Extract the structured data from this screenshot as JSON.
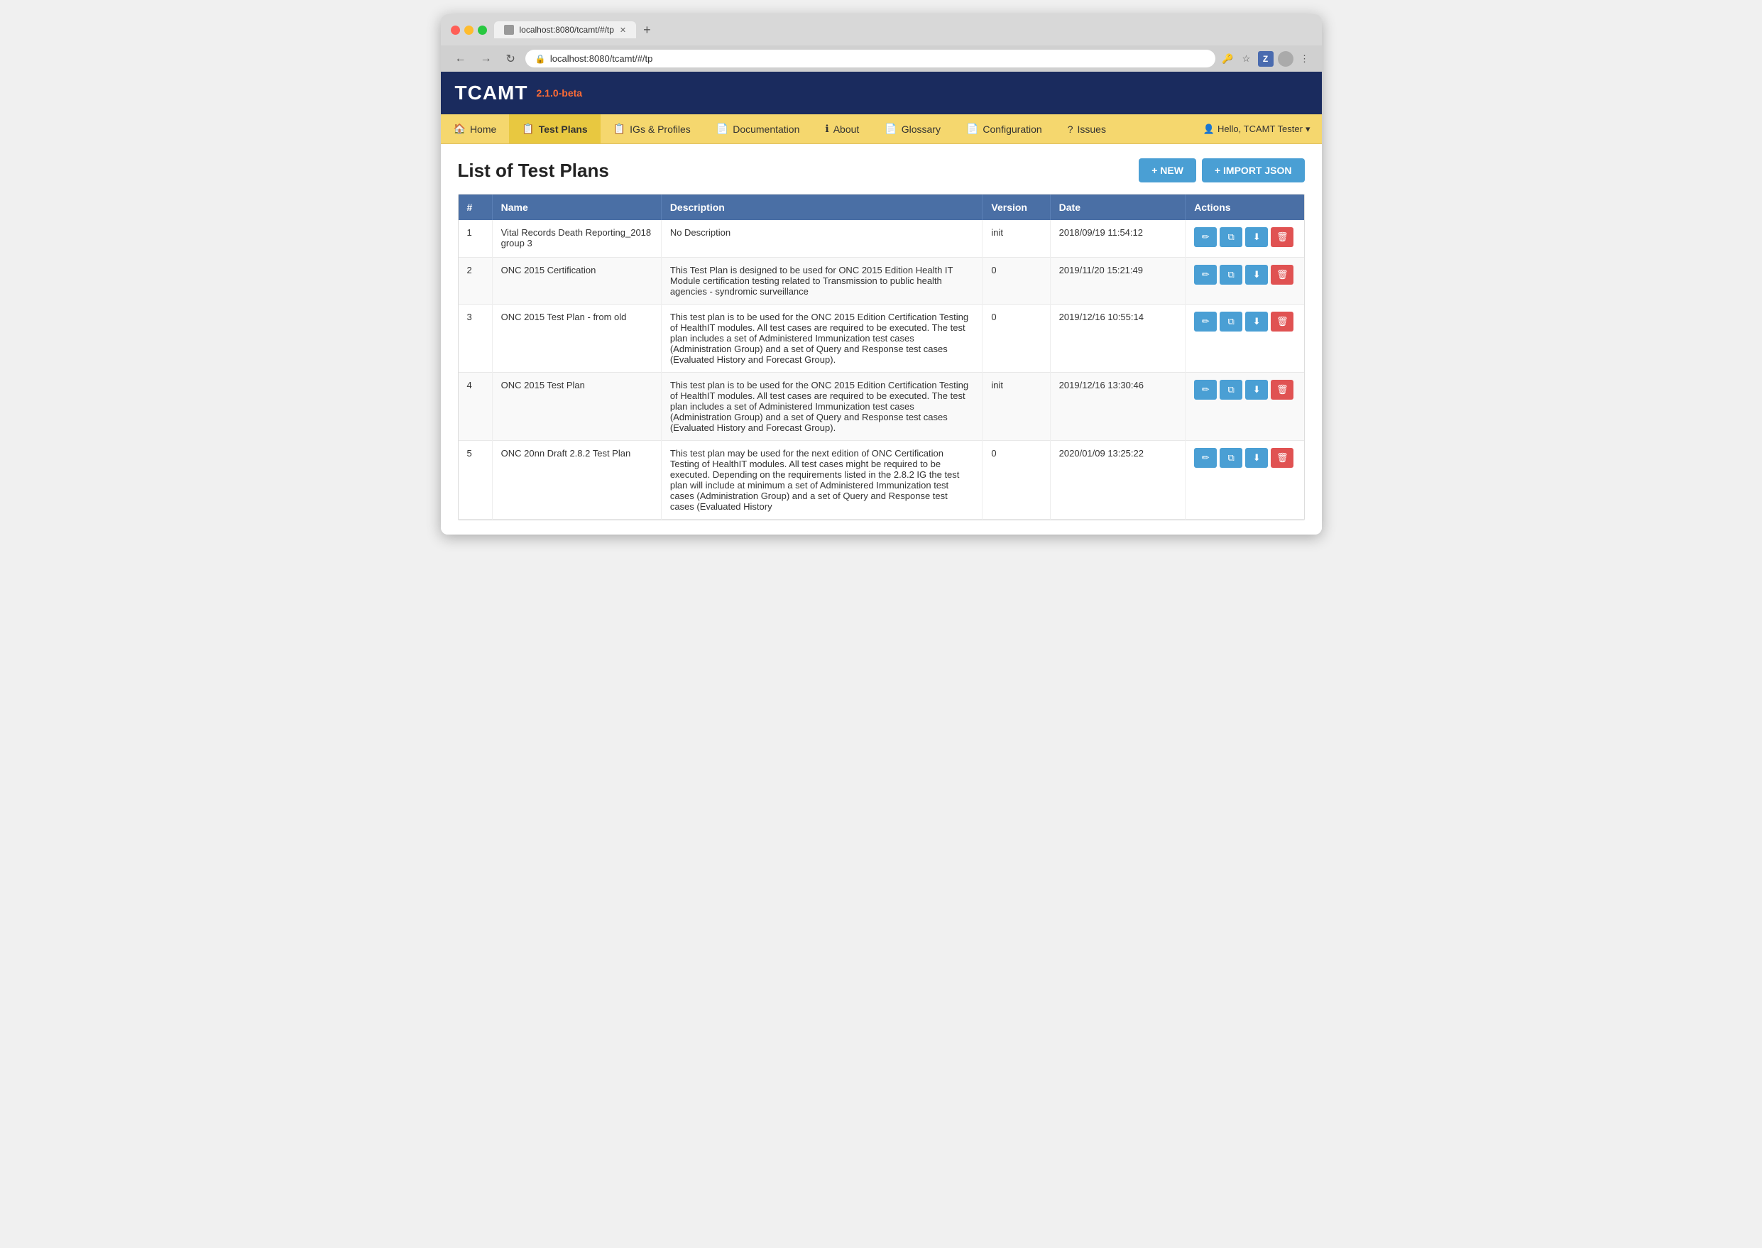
{
  "browser": {
    "tab_title": "localhost:8080/tcamt/#/tp",
    "url": "localhost:8080/tcamt/#/tp",
    "new_tab_label": "+"
  },
  "app": {
    "logo": "TCAMT",
    "version": "2.1.0-beta",
    "user_greeting": "Hello, TCAMT Tester"
  },
  "nav": {
    "items": [
      {
        "label": "Home",
        "icon": "🏠",
        "active": false
      },
      {
        "label": "Test Plans",
        "icon": "📋",
        "active": true
      },
      {
        "label": "IGs & Profiles",
        "icon": "📋",
        "active": false
      },
      {
        "label": "Documentation",
        "icon": "📄",
        "active": false
      },
      {
        "label": "About",
        "icon": "ℹ",
        "active": false
      },
      {
        "label": "Glossary",
        "icon": "📄",
        "active": false
      },
      {
        "label": "Configuration",
        "icon": "📄",
        "active": false
      },
      {
        "label": "Issues",
        "icon": "?",
        "active": false
      }
    ]
  },
  "page": {
    "title": "List of Test Plans",
    "new_button": "+ NEW",
    "import_button": "+ IMPORT JSON"
  },
  "table": {
    "columns": [
      "#",
      "Name",
      "Description",
      "Version",
      "Date",
      "Actions"
    ],
    "rows": [
      {
        "num": "1",
        "name": "Vital Records Death Reporting_2018 group 3",
        "description": "No Description",
        "version": "init",
        "date": "2018/09/19 11:54:12"
      },
      {
        "num": "2",
        "name": "ONC 2015 Certification",
        "description": "This Test Plan is designed to be used for ONC 2015 Edition Health IT Module certification testing related to Transmission to public health agencies - syndromic surveillance",
        "version": "0",
        "date": "2019/11/20 15:21:49"
      },
      {
        "num": "3",
        "name": "ONC 2015 Test Plan - from old",
        "description": "This test plan is to be used for the ONC 2015 Edition Certification Testing of HealthIT modules. All test cases are required to be executed. The test plan includes a set of Administered Immunization test cases (Administration Group) and a set of Query and Response test cases (Evaluated History and Forecast Group).",
        "version": "0",
        "date": "2019/12/16 10:55:14"
      },
      {
        "num": "4",
        "name": "ONC 2015 Test Plan",
        "description": "This test plan is to be used for the ONC 2015 Edition Certification Testing of HealthIT modules. All test cases are required to be executed. The test plan includes a set of Administered Immunization test cases (Administration Group) and a set of Query and Response test cases (Evaluated History and Forecast Group).",
        "version": "init",
        "date": "2019/12/16 13:30:46"
      },
      {
        "num": "5",
        "name": "ONC 20nn Draft 2.8.2 Test Plan",
        "description": "This test plan may be used for the next edition of ONC Certification Testing of HealthIT modules. All test cases might be required to be executed. Depending on the requirements listed in the 2.8.2 IG the test plan will include at minimum a set of Administered Immunization test cases (Administration Group) and a set of Query and Response test cases (Evaluated History",
        "version": "0",
        "date": "2020/01/09 13:25:22"
      }
    ]
  },
  "icons": {
    "edit": "✏",
    "copy": "⧉",
    "download": "⬇",
    "delete": "🗑",
    "home": "🏠",
    "testplans": "📋",
    "igs": "📋",
    "docs": "📄",
    "about": "ℹ",
    "glossary": "📄",
    "config": "📄",
    "issues": "?",
    "user": "👤",
    "chevron": "▾",
    "key": "🔑",
    "star": "☆",
    "menu": "⋮"
  }
}
